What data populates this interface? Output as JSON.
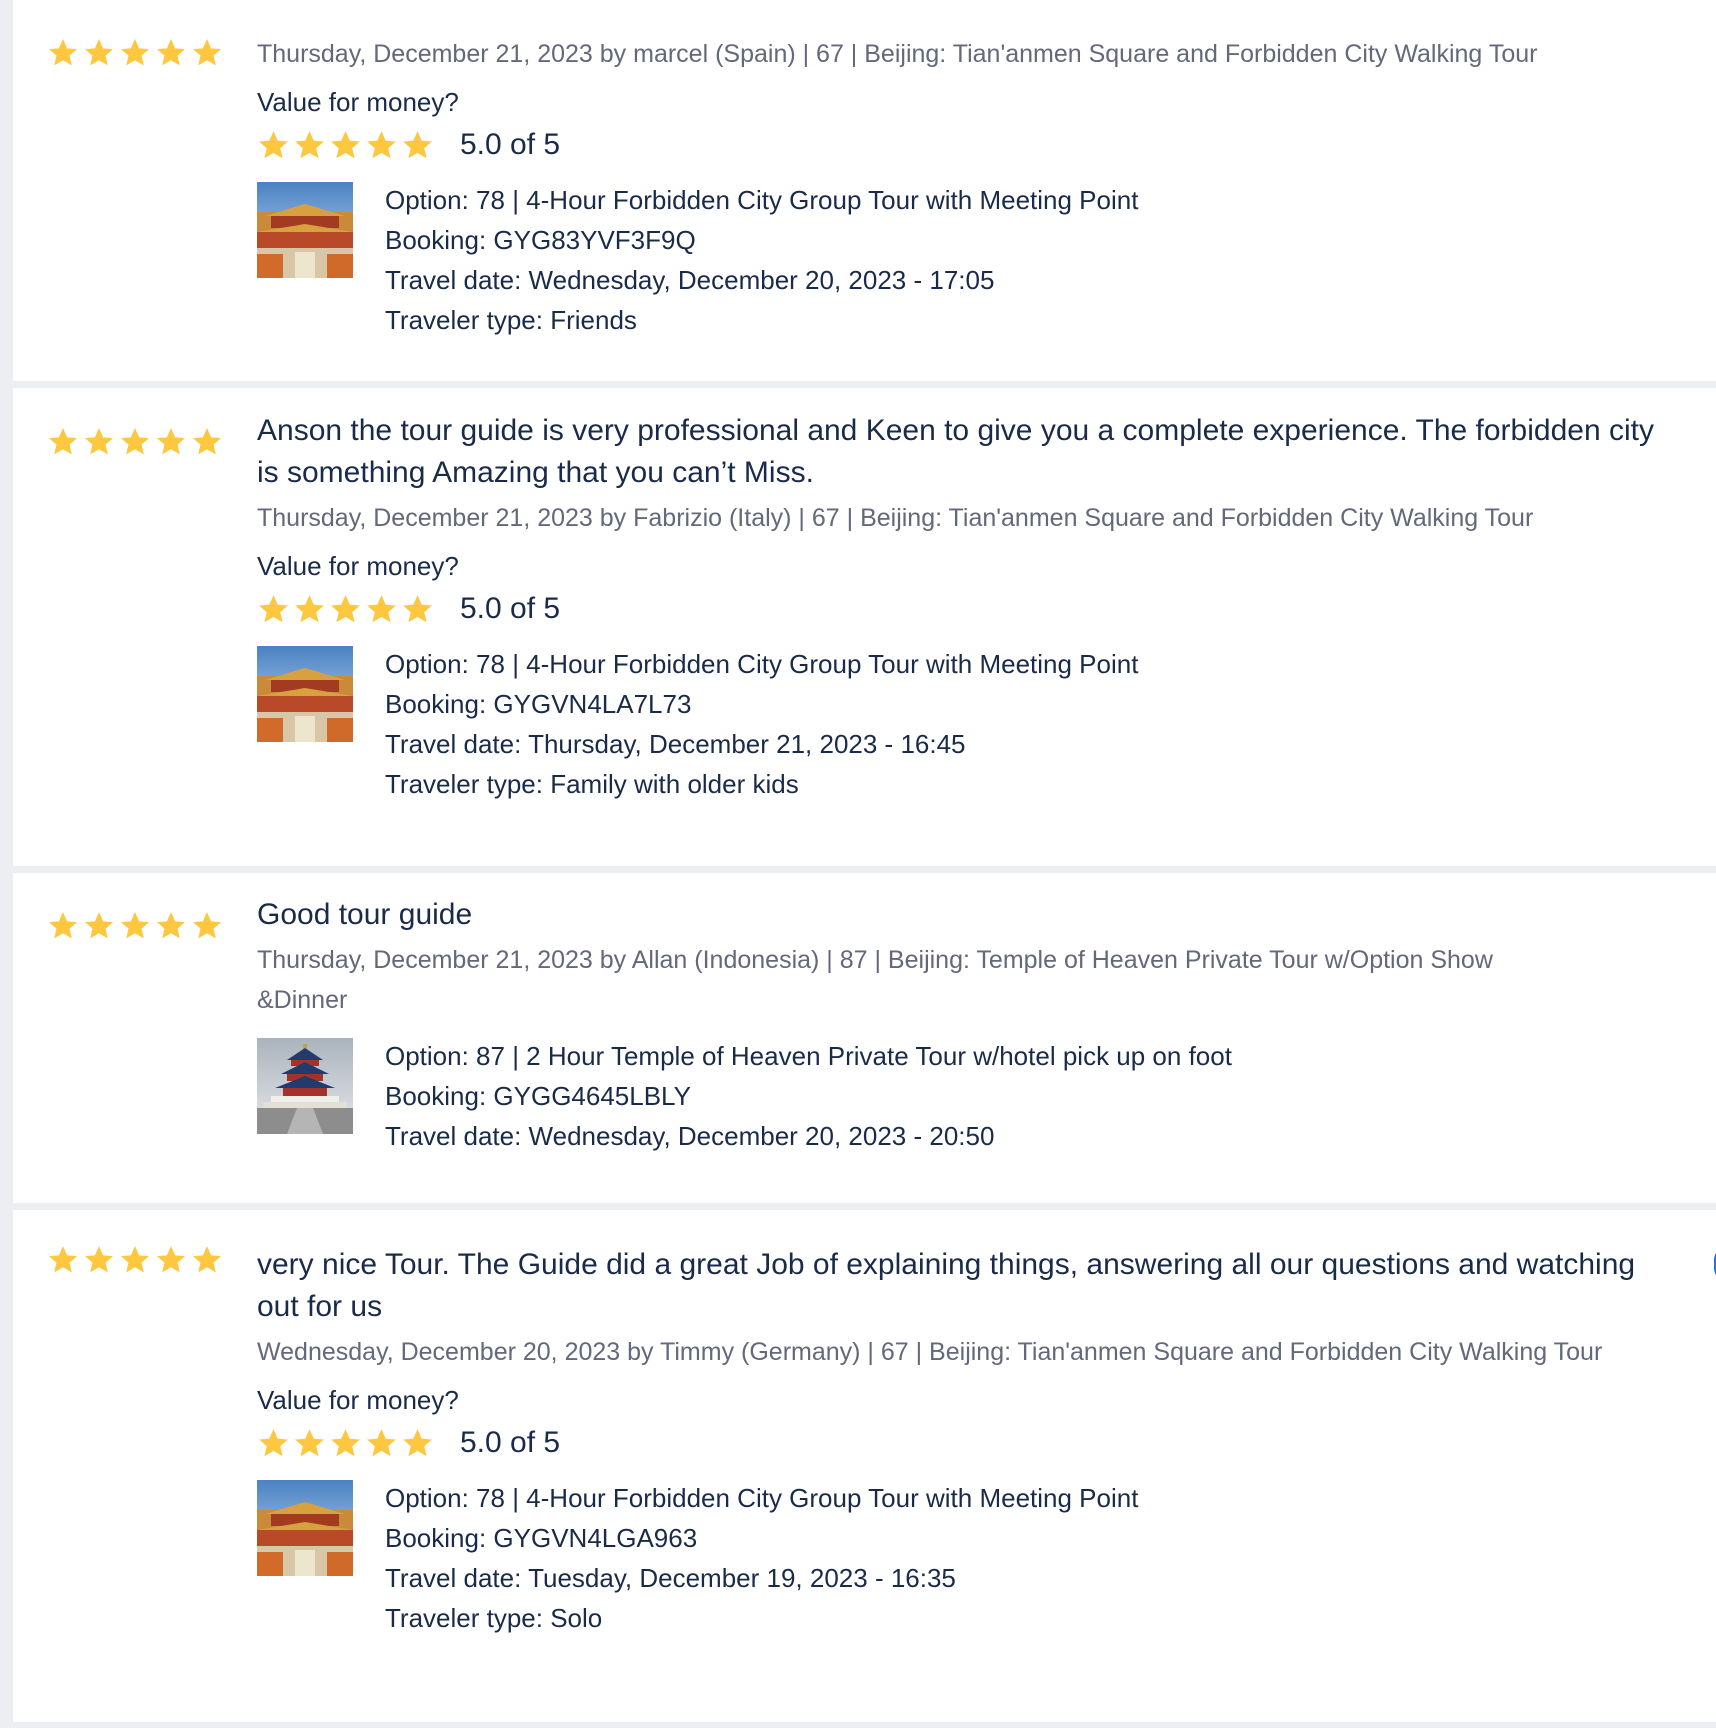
{
  "colors": {
    "star": "#fdc73f",
    "text": "#1a2b49",
    "meta": "#63687a",
    "background": "#eceef1"
  },
  "reviews": [
    {
      "rating": 5,
      "text": "",
      "meta": "Thursday, December 21, 2023 by marcel (Spain) | 67 | Beijing: Tian'anmen Square and Forbidden City Walking Tour",
      "value_label": "Value for money?",
      "value_rating": 5,
      "value_score": "5.0 of 5",
      "thumbnail": "forbidden-city-thumbnail",
      "option": "Option: 78 | 4-Hour Forbidden City Group Tour with Meeting Point",
      "booking": "Booking: GYG83YVF3F9Q",
      "travel_date": "Travel date: Wednesday, December 20, 2023 - 17:05",
      "traveler_type": "Traveler type: Friends"
    },
    {
      "rating": 5,
      "text": "Anson the tour guide is very professional and Keen to give you a complete experience. The forbidden city is something Amazing that you can’t Miss.",
      "meta": "Thursday, December 21, 2023 by Fabrizio (Italy) | 67 | Beijing: Tian'anmen Square and Forbidden City Walking Tour",
      "value_label": "Value for money?",
      "value_rating": 5,
      "value_score": "5.0 of 5",
      "thumbnail": "forbidden-city-thumbnail",
      "option": "Option: 78 | 4-Hour Forbidden City Group Tour with Meeting Point",
      "booking": "Booking: GYGVN4LA7L73",
      "travel_date": "Travel date: Thursday, December 21, 2023 - 16:45",
      "traveler_type": "Traveler type: Family with older kids"
    },
    {
      "rating": 5,
      "text": "Good tour guide",
      "meta": "Thursday, December 21, 2023 by Allan (Indonesia) | 87 | Beijing: Temple of Heaven Private Tour w/Option Show &Dinner",
      "thumbnail": "temple-of-heaven-thumbnail",
      "option": "Option: 87 | 2 Hour Temple of Heaven Private Tour w/hotel pick up on foot",
      "booking": "Booking: GYGG4645LBLY",
      "travel_date": "Travel date: Wednesday, December 20, 2023 - 20:50"
    },
    {
      "rating": 5,
      "text": "very nice Tour. The Guide did a great Job of explaining things, answering all our questions and watching out for us",
      "meta": "Wednesday, December 20, 2023 by Timmy (Germany) | 67 | Beijing: Tian'anmen Square and Forbidden City Walking Tour",
      "value_label": "Value for money?",
      "value_rating": 5,
      "value_score": "5.0 of 5",
      "thumbnail": "forbidden-city-thumbnail",
      "option": "Option: 78 | 4-Hour Forbidden City Group Tour with Meeting Point",
      "booking": "Booking: GYGVN4LGA963",
      "travel_date": "Travel date: Tuesday, December 19, 2023 - 16:35",
      "traveler_type": "Traveler type: Solo"
    }
  ]
}
